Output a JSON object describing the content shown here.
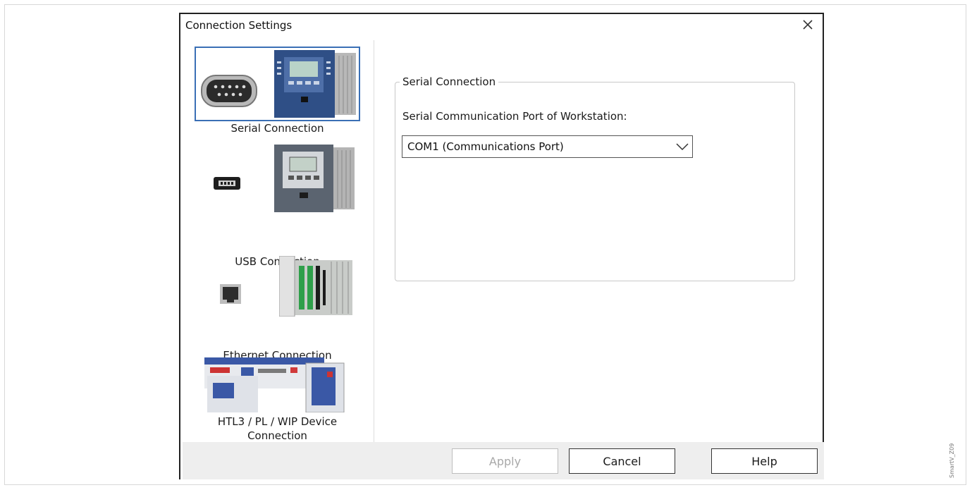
{
  "dialog": {
    "title": "Connection Settings",
    "close_icon": "close-icon"
  },
  "connections": {
    "items": [
      {
        "label": "Serial Connection",
        "selected": true,
        "icons": [
          "serial-port-icon",
          "protection-relay-icon"
        ]
      },
      {
        "label": "USB Connection",
        "selected": false,
        "icons": [
          "usb-port-icon",
          "protection-relay-icon"
        ]
      },
      {
        "label": "Ethernet Connection",
        "selected": false,
        "icons": [
          "ethernet-port-icon",
          "relay-rack-icon"
        ]
      },
      {
        "label_line1": "HTL3 / PL / WIP Device",
        "label_line2": "Connection",
        "selected": false,
        "icons": [
          "htl3-device-icon"
        ]
      }
    ]
  },
  "serial": {
    "group_title": "Serial Connection",
    "port_label": "Serial Communication Port of Workstation:",
    "port_value": "COM1 (Communications Port)"
  },
  "buttons": {
    "apply": "Apply",
    "cancel": "Cancel",
    "help": "Help"
  },
  "watermark": "SmartV_Z09",
  "colors": {
    "selection_border": "#3a6fb5",
    "button_bar": "#eeeeee",
    "disabled_text": "#a8a8a8"
  }
}
